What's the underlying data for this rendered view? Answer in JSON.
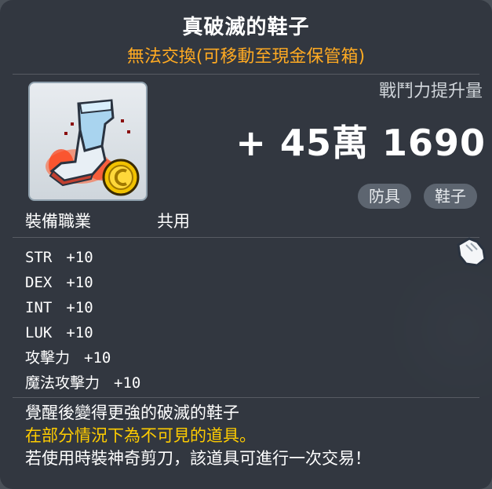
{
  "item": {
    "name": "真破滅的鞋子",
    "trade_note": "無法交換(可移動至現金保管箱)",
    "icon": "boots-item-icon"
  },
  "combat_power": {
    "label": "戰鬥力提升量",
    "value": "+ 45萬 1690"
  },
  "tags": [
    "防具",
    "鞋子"
  ],
  "job": {
    "label": "裝備職業",
    "value": "共用"
  },
  "stats": [
    {
      "name": "STR",
      "value": "+10"
    },
    {
      "name": "DEX",
      "value": "+10"
    },
    {
      "name": "INT",
      "value": "+10"
    },
    {
      "name": "LUK",
      "value": "+10"
    },
    {
      "name": "攻擊力",
      "value": "+10"
    },
    {
      "name": "魔法攻擊力",
      "value": "+10"
    }
  ],
  "description": {
    "line1": "覺醒後變得更強的破滅的鞋子",
    "line2": "在部分情況下為不可見的道具。",
    "line3": "若使用時裝神奇剪刀，該道具可進行一次交易！"
  },
  "colors": {
    "title": "#ffffff",
    "trade_note": "#ffaa22",
    "highlight": "#ffcc00",
    "panel": "#30363e"
  }
}
